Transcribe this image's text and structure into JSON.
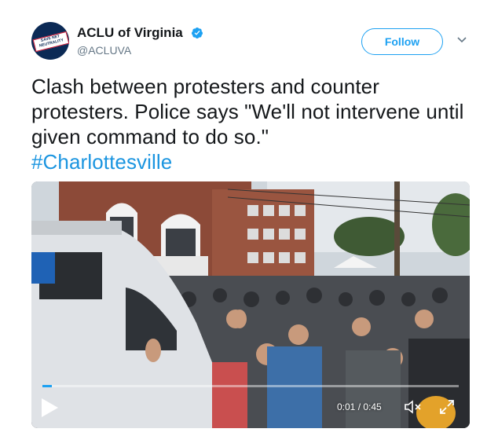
{
  "account": {
    "display_name": "ACLU of Virginia",
    "handle": "@ACLUVA",
    "avatar_text": "SAVE NET NEUTRALITY",
    "verified_icon": "verified-badge-icon"
  },
  "follow_button": {
    "label": "Follow"
  },
  "tweet": {
    "text": "Clash between protesters and counter protesters. Police says \"We'll not intervene until given command to do so.\"",
    "hashtag": "#Charlottesville"
  },
  "video": {
    "time": "0:01 / 0:45",
    "progress": 0.022,
    "icons": [
      "play-icon",
      "mute-icon",
      "fullscreen-icon"
    ]
  },
  "colors": {
    "accent": "#1da1f2",
    "hashtag": "#1b95e0",
    "text": "#14171a",
    "secondary": "#657786"
  }
}
